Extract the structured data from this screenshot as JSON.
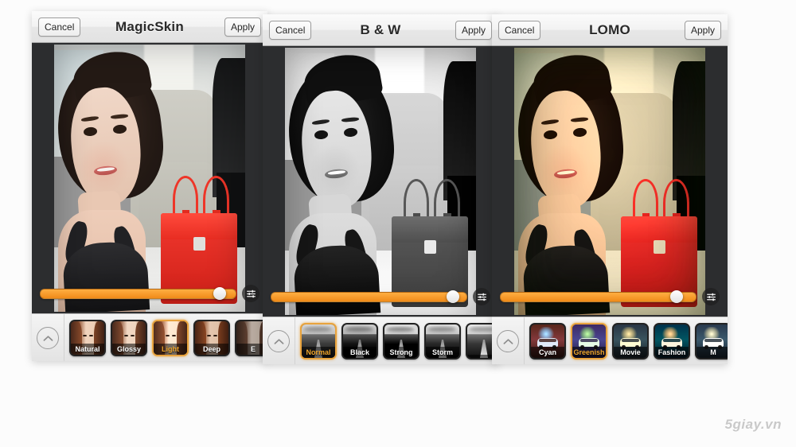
{
  "background_color": "#fcfcfc",
  "accent_color": "#e8a33d",
  "slider_color": "#f4941f",
  "watermark": "5giay.vn",
  "panels": [
    {
      "id": "magicskin",
      "nav": {
        "cancel_label": "Cancel",
        "title": "MagicSkin",
        "apply_label": "Apply",
        "cancel_icon": "cancel-button",
        "apply_icon": "apply-button"
      },
      "photo": {
        "alt": "selfie-of-woman-in-car-with-red-handbag",
        "filter_style": "color"
      },
      "slider": {
        "value_percent": 92,
        "adjust_icon": "sliders-icon"
      },
      "filter_strip": {
        "collapse_icon": "chevron-up-icon",
        "thumbs": [
          {
            "label": "Natural",
            "selected": false,
            "art": "hairface"
          },
          {
            "label": "Glossy",
            "selected": false,
            "art": "hairface glossy"
          },
          {
            "label": "Light",
            "selected": true,
            "art": "hairface light"
          },
          {
            "label": "Deep",
            "selected": false,
            "art": "hairface deep"
          },
          {
            "label": "E",
            "selected": false,
            "art": "hairface extra"
          }
        ]
      }
    },
    {
      "id": "bw",
      "nav": {
        "cancel_label": "Cancel",
        "title": "B & W",
        "apply_label": "Apply",
        "cancel_icon": "cancel-button",
        "apply_icon": "apply-button"
      },
      "photo": {
        "alt": "selfie-of-woman-in-car-black-and-white",
        "filter_style": "black-and-white"
      },
      "slider": {
        "value_percent": 93,
        "adjust_icon": "sliders-icon"
      },
      "filter_strip": {
        "collapse_icon": "chevron-up-icon",
        "thumbs": [
          {
            "label": "Normal",
            "selected": true,
            "art": "road bw1"
          },
          {
            "label": "Black",
            "selected": false,
            "art": "road bw2"
          },
          {
            "label": "Strong",
            "selected": false,
            "art": "road bw3"
          },
          {
            "label": "Storm",
            "selected": false,
            "art": "road bw4"
          },
          {
            "label": "",
            "selected": false,
            "art": "road bw5"
          }
        ]
      }
    },
    {
      "id": "lomo",
      "nav": {
        "cancel_label": "Cancel",
        "title": "LOMO",
        "apply_label": "Apply",
        "cancel_icon": "cancel-button",
        "apply_icon": "apply-button"
      },
      "photo": {
        "alt": "selfie-of-woman-in-car-lomo-greenish-tint",
        "filter_style": "lomo-greenish"
      },
      "slider": {
        "value_percent": 90,
        "adjust_icon": "sliders-icon"
      },
      "filter_strip": {
        "collapse_icon": "chevron-up-icon",
        "thumbs": [
          {
            "label": "Cyan",
            "selected": false,
            "art": "van lomo-cyan"
          },
          {
            "label": "Greenish",
            "selected": true,
            "art": "van lomo-green"
          },
          {
            "label": "Movie",
            "selected": false,
            "art": "van lomo-movie"
          },
          {
            "label": "Fashion",
            "selected": false,
            "art": "van lomo-fashion"
          },
          {
            "label": "M",
            "selected": false,
            "art": "van lomo-more"
          }
        ]
      }
    }
  ]
}
